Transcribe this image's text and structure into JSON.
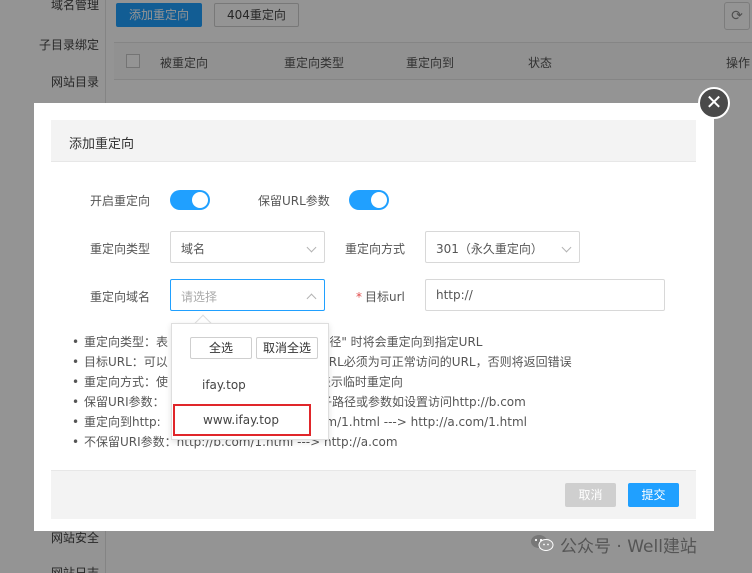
{
  "sidebar": {
    "items": [
      {
        "label": "域名管理"
      },
      {
        "label": "子目录绑定"
      },
      {
        "label": "网站目录"
      },
      {
        "label": "网站安全"
      },
      {
        "label": "网站日志"
      }
    ]
  },
  "toolbar": {
    "add_redirect_label": "添加重定向",
    "redirect_404_label": "404重定向"
  },
  "table": {
    "columns": [
      "被重定向",
      "重定向类型",
      "重定向到",
      "状态",
      "操作"
    ]
  },
  "dialog": {
    "title": "添加重定向",
    "close_glyph": "✕",
    "form": {
      "enable_redirect_label": "开启重定向",
      "enable_redirect_on": true,
      "keep_url_params_label": "保留URL参数",
      "keep_url_params_on": true,
      "redirect_type_label": "重定向类型",
      "redirect_type_value": "域名",
      "redirect_method_label": "重定向方式",
      "redirect_method_value": "301（永久重定向）",
      "redirect_domain_label": "重定向域名",
      "redirect_domain_placeholder": "请选择",
      "target_url_label": "目标url",
      "target_url_required_mark": "*",
      "target_url_value": "http://"
    },
    "help": [
      "重定向类型：表",
      "目标URL：可以",
      "重定向方式：使",
      "保留URI参数：",
      "重定向到http:",
      "不保留URI参数：http://b.com/1.html ---> http://a.com"
    ],
    "help_tail": [
      "的 \"路径\" 时将会重定向到指定URL",
      "目标URL必须为可正常访问的URL，否则将返回错误",
      "302表示临时重定向",
      "带有子路径或参数如设置访问http://b.com",
      "/b.com/1.html ---> http://a.com/1.html"
    ],
    "footer": {
      "cancel_label": "取消",
      "submit_label": "提交"
    }
  },
  "dropdown": {
    "select_all_label": "全选",
    "deselect_all_label": "取消全选",
    "options": [
      {
        "label": "ifay.top",
        "highlighted": false
      },
      {
        "label": "www.ifay.top",
        "highlighted": true
      }
    ]
  },
  "watermark": {
    "text": "公众号 · Well建站"
  },
  "colors": {
    "accent": "#20a0ff",
    "highlight_box": "#e0262a",
    "disabled_button": "#cfcfcf"
  },
  "icons": {
    "close": "close-icon",
    "refresh": "refresh-icon",
    "chevron": "chevron-down-icon",
    "wechat": "wechat-icon"
  }
}
